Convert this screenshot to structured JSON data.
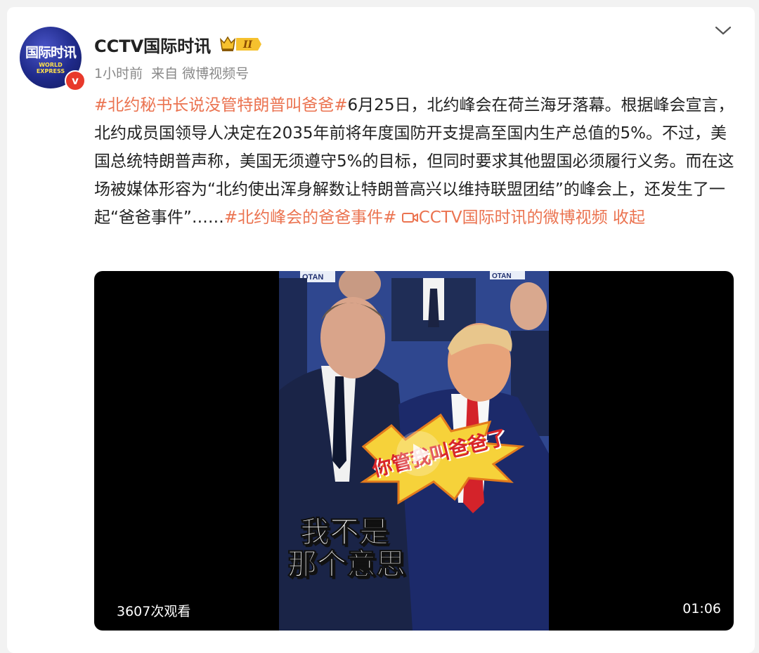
{
  "post": {
    "author": "CCTV国际时讯",
    "avatar_text": "国际时讯",
    "avatar_subtext": "WORLD EXPRESS",
    "verified_mark": "v",
    "badge_text": "II",
    "time": "1小时前",
    "source": "来自 微博视频号",
    "topic1": "#北约秘书长说没管特朗普叫爸爸#",
    "body": "6月25日，北约峰会在荷兰海牙落幕。根据峰会宣言，北约成员国领导人决定在2035年前将年度国防开支提高至国内生产总值的5%。不过，美国总统特朗普声称，美国无须遵守5%的目标，但同时要求其他盟国必须履行义务。而在这场被媒体形容为“北约使出浑身解数让特朗普高兴以维持联盟团结”的峰会上，还发生了一起“爸爸事件”……",
    "topic2": "#北约峰会的爸爸事件#",
    "video_link": "CCTV国际时讯的微博视频",
    "collapse": "收起"
  },
  "video": {
    "views": "3607次观看",
    "duration": "01:06",
    "caption_burst": "你管我叫爸爸了",
    "caption_line1": "我不是",
    "caption_line2": "那个意思",
    "backdrop_text_left": "OTAN",
    "backdrop_text_right": "OTAN"
  },
  "colors": {
    "accent": "#eb7350",
    "verified": "#e8392b"
  }
}
